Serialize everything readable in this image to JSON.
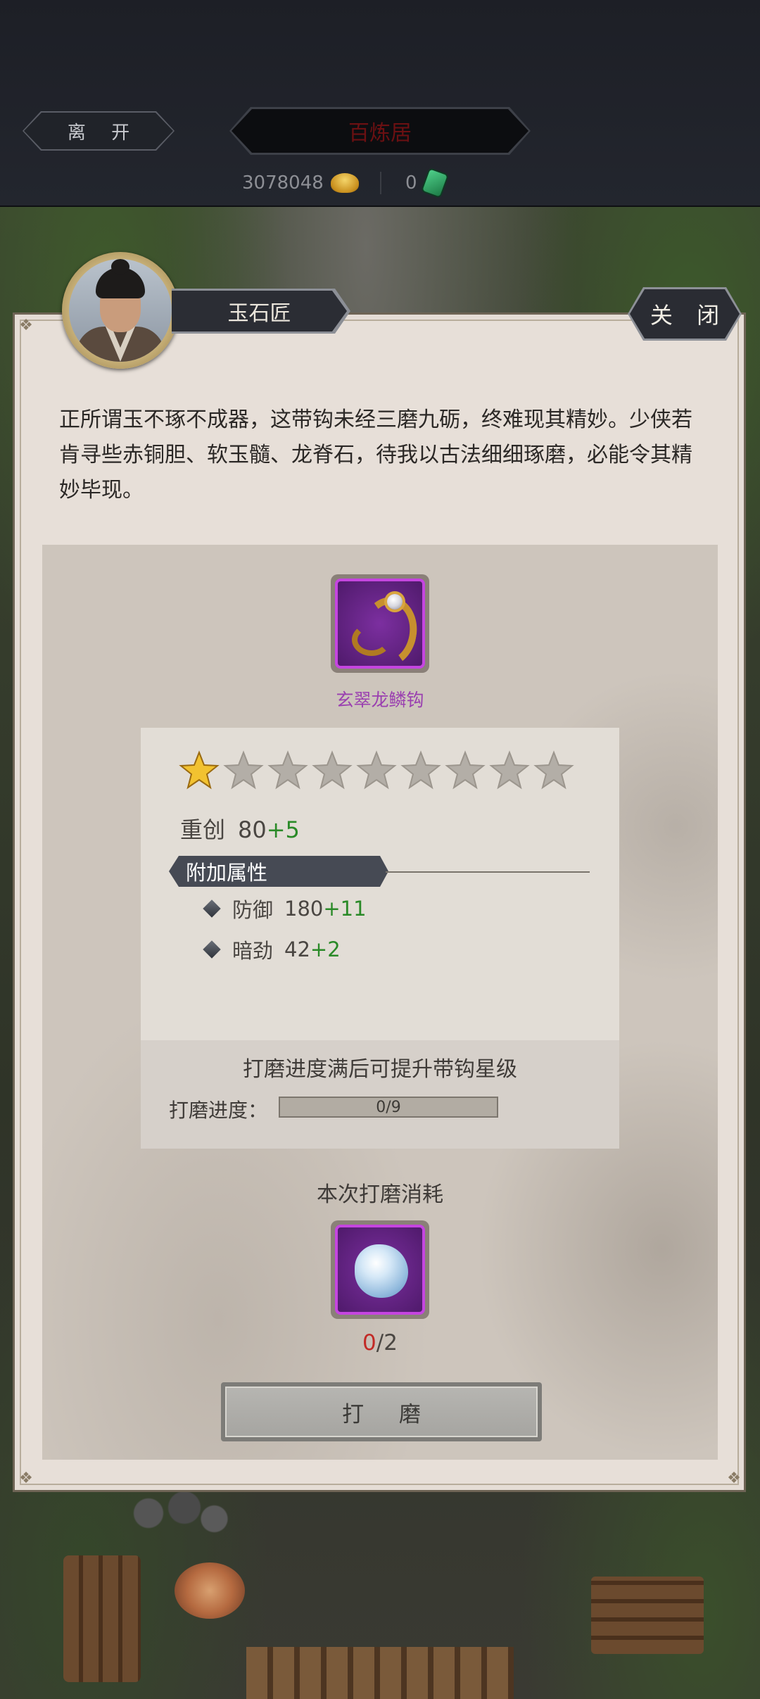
{
  "topbar": {
    "leave_label": "离 开",
    "title": "百炼居",
    "gold_amount": "3078048",
    "jade_amount": "0"
  },
  "npc": {
    "name": "玉石匠",
    "close_label": "关 闭",
    "dialog": "正所谓玉不琢不成器，这带钩未经三磨九砺，终难现其精妙。少侠若肯寻些赤铜胆、软玉髓、龙脊石，待我以古法细细琢磨，必能令其精妙毕现。"
  },
  "item": {
    "name": "玄翠龙鳞钩",
    "stars_total": 9,
    "stars_filled": 1,
    "main_stat": {
      "label": "重创",
      "value": "80",
      "bonus": "+5"
    },
    "section_title": "附加属性",
    "sub_stats": [
      {
        "label": "防御",
        "value": "180",
        "bonus": "+11"
      },
      {
        "label": "暗劲",
        "value": "42",
        "bonus": "+2"
      }
    ],
    "progress_hint": "打磨进度满后可提升带钩星级",
    "progress_label": "打磨进度：",
    "progress_text": "0/9",
    "progress_fraction": 0
  },
  "cost": {
    "title": "本次打磨消耗",
    "have": "0",
    "need": "/2"
  },
  "action": {
    "polish_label": "打 磨"
  },
  "colors": {
    "rarity_purple": "#c545e0",
    "bonus_green": "#2a8a28",
    "insufficient_red": "#c22a26",
    "item_name_purple": "#9a3fb0"
  },
  "icons": {
    "gold": "gold-ingot-icon",
    "jade": "jade-ticket-icon",
    "star_filled": "star-gold-icon",
    "star_empty": "star-grey-icon",
    "material": "jade-stone-icon"
  }
}
